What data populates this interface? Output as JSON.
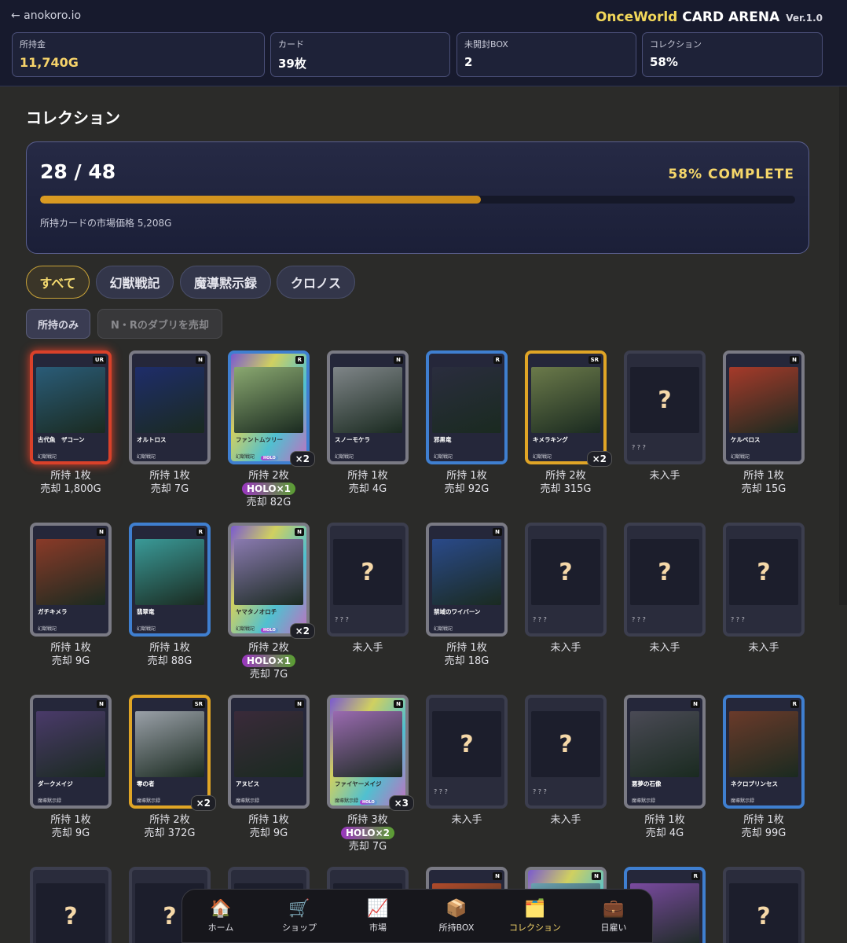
{
  "header": {
    "back_label": "← anokoro.io",
    "brand_name": "OnceWorld",
    "brand_rest": "CARD ARENA",
    "version": "Ver.1.0",
    "stats": [
      {
        "label": "所持金",
        "value": "11,740G"
      },
      {
        "label": "カード",
        "value": "39枚"
      },
      {
        "label": "未開封BOX",
        "value": "2"
      },
      {
        "label": "コレクション",
        "value": "58%"
      }
    ]
  },
  "page": {
    "title": "コレクション"
  },
  "progress": {
    "count": "28 / 48",
    "owned": 28,
    "total": 48,
    "complete_label": "58% COMPLETE",
    "market_value_label": "所持カードの市場価格 5,208G"
  },
  "tabs": [
    "すべて",
    "幻獣戦記",
    "魔導黙示録",
    "クロノス"
  ],
  "filters": {
    "owned_only": "所持のみ",
    "sell_duplicates": "N・Rのダブリを売却"
  },
  "cards": [
    {
      "name": "古代魚　ザコーン",
      "set": "幻獣戦記",
      "rarity": "UR",
      "owned": "所持 1枚",
      "sell": "売却 1,800G",
      "art_color": "#2a5c78"
    },
    {
      "name": "オルトロス",
      "set": "幻獣戦記",
      "rarity": "N",
      "owned": "所持 1枚",
      "sell": "売却 7G",
      "art_color": "#1e2d6a"
    },
    {
      "name": "ファントムツリー",
      "set": "幻獣戦記",
      "rarity": "R",
      "holo": true,
      "qty": "×2",
      "owned": "所持 2枚",
      "holo_label": "HOLO×1",
      "sell": "売却 82G",
      "art_color": "#8aa870"
    },
    {
      "name": "スノーモケラ",
      "set": "幻獣戦記",
      "rarity": "N",
      "owned": "所持 1枚",
      "sell": "売却 4G",
      "art_color": "#7f8588"
    },
    {
      "name": "邪黒竜",
      "set": "幻獣戦記",
      "rarity": "R",
      "owned": "所持 1枚",
      "sell": "売却 92G",
      "art_color": "#2a2d3e"
    },
    {
      "name": "キメラキング",
      "set": "幻獣戦記",
      "rarity": "SR",
      "qty": "×2",
      "owned": "所持 2枚",
      "sell": "売却 315G",
      "art_color": "#6b7a4a"
    },
    {
      "unknown": true,
      "name": "? ? ?",
      "owned": "未入手"
    },
    {
      "name": "ケルベロス",
      "set": "幻獣戦記",
      "rarity": "N",
      "owned": "所持 1枚",
      "sell": "売却 15G",
      "art_color": "#a63a2a"
    },
    {
      "name": "ガチキメラ",
      "set": "幻獣戦記",
      "rarity": "N",
      "owned": "所持 1枚",
      "sell": "売却 9G",
      "art_color": "#8a3a28"
    },
    {
      "name": "翡翠竜",
      "set": "幻獣戦記",
      "rarity": "R",
      "owned": "所持 1枚",
      "sell": "売却 88G",
      "art_color": "#3a9a98"
    },
    {
      "name": "ヤマタノオロチ",
      "set": "幻獣戦記",
      "rarity": "N",
      "holo": true,
      "qty": "×2",
      "owned": "所持 2枚",
      "holo_label": "HOLO×1",
      "sell": "売却 7G",
      "art_color": "#8a7ab0"
    },
    {
      "unknown": true,
      "name": "? ? ?",
      "owned": "未入手"
    },
    {
      "name": "禁域のワイバーン",
      "set": "幻獣戦記",
      "rarity": "N",
      "owned": "所持 1枚",
      "sell": "売却 18G",
      "art_color": "#2a4a8a"
    },
    {
      "unknown": true,
      "name": "? ? ?",
      "owned": "未入手"
    },
    {
      "unknown": true,
      "name": "? ? ?",
      "owned": "未入手"
    },
    {
      "unknown": true,
      "name": "? ? ?",
      "owned": "未入手"
    },
    {
      "name": "ダークメイジ",
      "set": "魔導黙示録",
      "rarity": "N",
      "owned": "所持 1枚",
      "sell": "売却 9G",
      "art_color": "#4a3a6a"
    },
    {
      "name": "零の者",
      "set": "魔導黙示録",
      "rarity": "SR",
      "qty": "×2",
      "owned": "所持 2枚",
      "sell": "売却 372G",
      "art_color": "#9aa0a8"
    },
    {
      "name": "アヌビス",
      "set": "魔導黙示録",
      "rarity": "N",
      "owned": "所持 1枚",
      "sell": "売却 9G",
      "art_color": "#3a2a3a"
    },
    {
      "name": "ファイヤーメイジ",
      "set": "魔導黙示録",
      "rarity": "N",
      "holo": true,
      "qty": "×3",
      "owned": "所持 3枚",
      "holo_label": "HOLO×2",
      "sell": "売却 7G",
      "art_color": "#9a6ab0"
    },
    {
      "unknown": true,
      "name": "? ? ?",
      "owned": "未入手"
    },
    {
      "unknown": true,
      "name": "? ? ?",
      "owned": "未入手"
    },
    {
      "name": "悪夢の石像",
      "set": "魔導黙示録",
      "rarity": "N",
      "owned": "所持 1枚",
      "sell": "売却 4G",
      "art_color": "#4a4a55"
    },
    {
      "name": "ネクロプリンセス",
      "set": "魔導黙示録",
      "rarity": "R",
      "owned": "所持 1枚",
      "sell": "売却 99G",
      "art_color": "#6a3a2a"
    },
    {
      "unknown": true
    },
    {
      "unknown": true
    },
    {
      "unknown": true
    },
    {
      "unknown": true
    },
    {
      "rarity": "N",
      "art_color": "#b04a2a"
    },
    {
      "rarity": "N",
      "holo": true,
      "art_color": "#6aa0b0"
    },
    {
      "rarity": "R",
      "art_color": "#7a4aa0"
    },
    {
      "unknown": true
    }
  ],
  "nav": [
    {
      "icon": "🏠",
      "label": "ホーム"
    },
    {
      "icon": "🛒",
      "label": "ショップ"
    },
    {
      "icon": "📈",
      "label": "市場"
    },
    {
      "icon": "📦",
      "label": "所持BOX"
    },
    {
      "icon": "🗂️",
      "label": "コレクション",
      "active": true
    },
    {
      "icon": "💼",
      "label": "日雇い"
    }
  ],
  "colors": {
    "accent": "#f5d66a",
    "ur": "#d9412a",
    "sr": "#e0a526",
    "r": "#3f7fd0",
    "n": "#7a7a84"
  }
}
